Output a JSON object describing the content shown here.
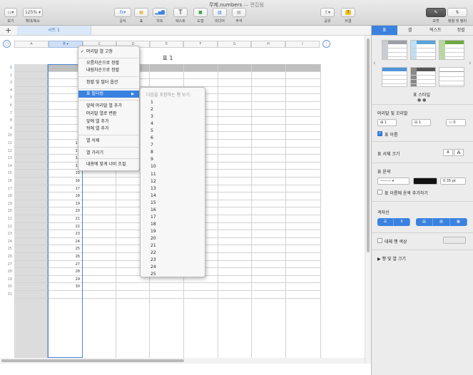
{
  "window": {
    "title": "무제.numbers",
    "title_suffix": "— 편집됨"
  },
  "toolbar": {
    "view_label": "보기",
    "zoom_value": "125%",
    "zoom_label": "확대/축소",
    "formula_label": "공식",
    "table_label": "표",
    "chart_label": "차트",
    "text_label": "텍스트",
    "shape_label": "도형",
    "media_label": "미디어",
    "comment_label": "주석",
    "share_label": "공유",
    "tips_label": "비결",
    "format_label": "포맷",
    "sort_filter_label": "정렬 및 필터"
  },
  "sheet_tabs": {
    "add": "+",
    "tabs": [
      "시트 1"
    ]
  },
  "table": {
    "title": "표 1",
    "columns": [
      "A",
      "B",
      "C",
      "D",
      "E",
      "F",
      "G",
      "H",
      "I"
    ],
    "row_numbers": [
      1,
      2,
      3,
      4,
      5,
      6,
      7,
      8,
      9,
      10,
      11,
      12,
      13,
      14,
      15,
      16,
      17,
      18,
      19,
      20,
      21,
      22,
      23,
      24,
      25,
      26,
      27,
      28,
      29,
      30,
      31
    ],
    "b_values": [
      "",
      "",
      "",
      "",
      "",
      "",
      "",
      "",
      "",
      "",
      "11",
      "12",
      "13",
      "14",
      "15",
      "16",
      "17",
      "18",
      "19",
      "20",
      "21",
      "22",
      "23",
      "24",
      "25",
      "26",
      "27",
      "28",
      "29",
      "30",
      ""
    ]
  },
  "context_menu": {
    "items": [
      {
        "label": "머리말 열 고정",
        "checked": true
      },
      {
        "label": "오름차순으로 정렬"
      },
      {
        "label": "내림차순으로 정렬"
      },
      {
        "label": "정렬 및 필터 옵션"
      },
      {
        "label": "표 필터링",
        "submenu": true
      },
      {
        "label": "앞에 머리말 열 추가"
      },
      {
        "label": "머리말 열로 변환"
      },
      {
        "label": "앞에 열 추가"
      },
      {
        "label": "뒤에 열 추가"
      },
      {
        "label": "열 삭제"
      },
      {
        "label": "열 가리기"
      },
      {
        "label": "내용에 맞게 너비 조절"
      }
    ]
  },
  "filter_submenu": {
    "header": "다음을 포함하는 행 보기:",
    "values": [
      "1",
      "2",
      "3",
      "4",
      "5",
      "6",
      "7",
      "8",
      "9",
      "10",
      "11",
      "12",
      "13",
      "14",
      "15",
      "16",
      "17",
      "18",
      "19",
      "20",
      "21",
      "22",
      "23",
      "24",
      "25"
    ]
  },
  "inspector": {
    "tabs": [
      "표",
      "셀",
      "텍스트",
      "정렬"
    ],
    "style_caption": "표 스타일",
    "headers_footer_label": "머리말 및 꼬리말",
    "header_rows": "1",
    "header_cols": "1",
    "footer_rows": "0",
    "table_name_label": "표 이름",
    "font_size_label": "표 서체 크기",
    "font_smaller": "A",
    "font_larger": "A",
    "outline_label": "표 윤곽",
    "outline_width": "0.35 pt",
    "outline_name_label": "표 이름에 윤곽 추가하기",
    "gridlines_label": "격자선",
    "alt_row_label": "대체 행 색상",
    "row_col_size_label": "행 및 열 크기",
    "accent_color": "#3b82e0"
  }
}
